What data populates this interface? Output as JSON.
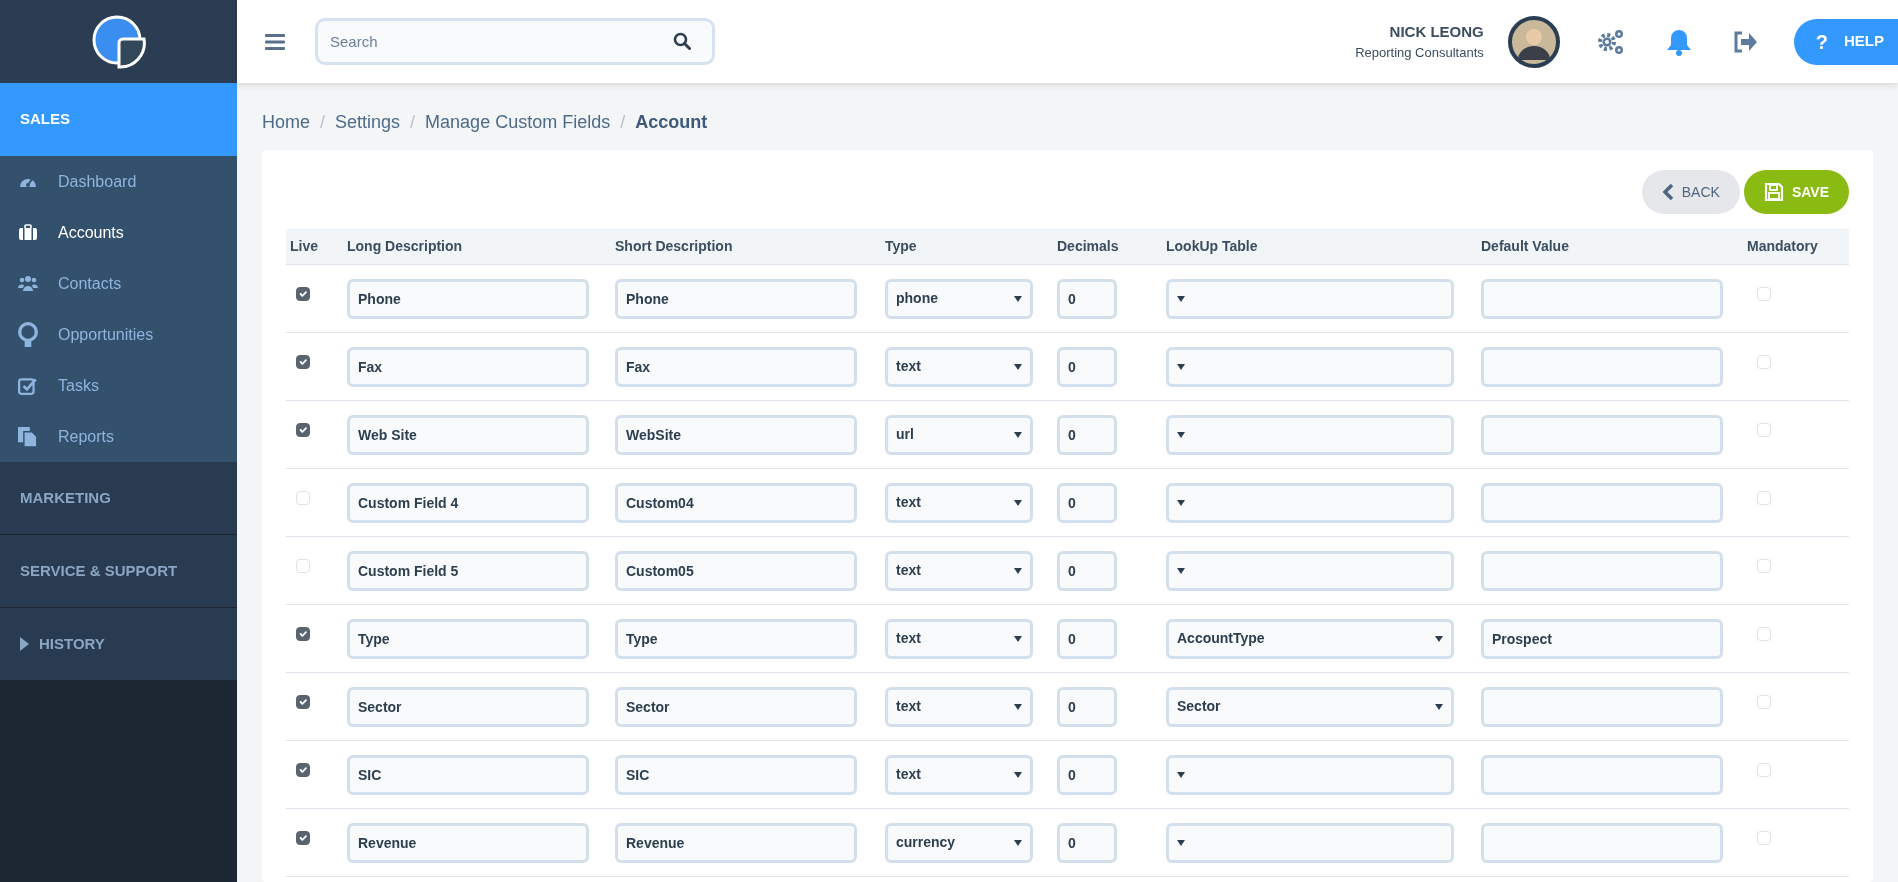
{
  "header": {
    "search": {
      "placeholder": "Search"
    },
    "user": {
      "name": "NICK LEONG",
      "company": "Reporting Consultants"
    },
    "help": {
      "icon": "?",
      "label": "HELP"
    }
  },
  "sidebar": {
    "sections": [
      {
        "kind": "menu",
        "label": "SALES",
        "selected": true,
        "items": [
          {
            "label": "Dashboard",
            "selected": false
          },
          {
            "label": "Accounts",
            "selected": true
          },
          {
            "label": "Contacts",
            "selected": false
          },
          {
            "label": "Opportunities",
            "selected": false
          },
          {
            "label": "Tasks",
            "selected": false
          },
          {
            "label": "Reports",
            "selected": false
          }
        ]
      },
      {
        "kind": "link",
        "label": "MARKETING",
        "selected": false
      },
      {
        "kind": "link",
        "label": "SERVICE & SUPPORT",
        "selected": false
      },
      {
        "kind": "collapsible",
        "label": "HISTORY",
        "selected": false
      }
    ]
  },
  "breadcrumb": [
    {
      "kind": "link",
      "label": "Home"
    },
    {
      "kind": "separator",
      "label": "/"
    },
    {
      "kind": "link",
      "label": "Settings"
    },
    {
      "kind": "separator",
      "label": "/"
    },
    {
      "kind": "link",
      "label": "Manage Custom Fields"
    },
    {
      "kind": "separator",
      "label": "/"
    },
    {
      "kind": "current",
      "label": "Account"
    }
  ],
  "buttons": [
    {
      "kind": "back",
      "label": "BACK"
    },
    {
      "kind": "save",
      "label": "SAVE"
    }
  ],
  "table": {
    "columns": [
      "Live",
      "Long Description",
      "Short Description",
      "Type",
      "Decimals",
      "LookUp Table",
      "Default Value",
      "Mandatory"
    ],
    "rows": [
      {
        "live": true,
        "long": "Phone",
        "short": "Phone",
        "type": "phone",
        "decimals": "0",
        "lookup": "",
        "default": "",
        "mandatory": false
      },
      {
        "live": true,
        "long": "Fax",
        "short": "Fax",
        "type": "text",
        "decimals": "0",
        "lookup": "",
        "default": "",
        "mandatory": false
      },
      {
        "live": true,
        "long": "Web Site",
        "short": "WebSite",
        "type": "url",
        "decimals": "0",
        "lookup": "",
        "default": "",
        "mandatory": false
      },
      {
        "live": false,
        "long": "Custom Field 4",
        "short": "Custom04",
        "type": "text",
        "decimals": "0",
        "lookup": "",
        "default": "",
        "mandatory": false
      },
      {
        "live": false,
        "long": "Custom Field 5",
        "short": "Custom05",
        "type": "text",
        "decimals": "0",
        "lookup": "",
        "default": "",
        "mandatory": false
      },
      {
        "live": true,
        "long": "Type",
        "short": "Type",
        "type": "text",
        "decimals": "0",
        "lookup": "AccountType",
        "default": "Prospect",
        "mandatory": false
      },
      {
        "live": true,
        "long": "Sector",
        "short": "Sector",
        "type": "text",
        "decimals": "0",
        "lookup": "Sector",
        "default": "",
        "mandatory": false
      },
      {
        "live": true,
        "long": "SIC",
        "short": "SIC",
        "type": "text",
        "decimals": "0",
        "lookup": "",
        "default": "",
        "mandatory": false
      },
      {
        "live": true,
        "long": "Revenue",
        "short": "Revenue",
        "type": "currency",
        "decimals": "0",
        "lookup": "",
        "default": "",
        "mandatory": false
      }
    ]
  }
}
